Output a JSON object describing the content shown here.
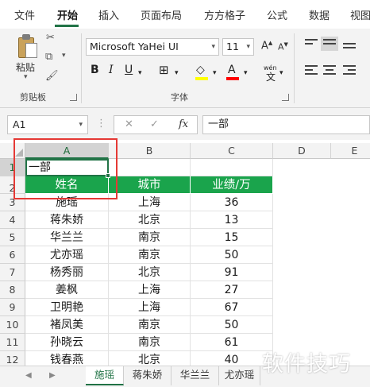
{
  "ribbon_tabs": [
    {
      "label": "文件"
    },
    {
      "label": "开始"
    },
    {
      "label": "插入"
    },
    {
      "label": "页面布局"
    },
    {
      "label": "方方格子"
    },
    {
      "label": "公式"
    },
    {
      "label": "数据"
    },
    {
      "label": "视图"
    }
  ],
  "clipboard": {
    "paste_label": "粘贴",
    "group_label": "剪贴板"
  },
  "font": {
    "name": "Microsoft YaHei UI",
    "size": "11",
    "group_label": "字体",
    "phonetic_label": "wén",
    "fill_color": "#ffff00",
    "font_color": "#ff0000"
  },
  "formula_bar": {
    "name_box": "A1",
    "fx_label": "fx",
    "formula_value": "一部"
  },
  "columns": [
    "A",
    "B",
    "C",
    "D",
    "E"
  ],
  "rows": [
    "1",
    "2",
    "3",
    "4",
    "5",
    "6",
    "7",
    "8",
    "9",
    "10",
    "11",
    "12"
  ],
  "a1_value": "一部",
  "table": {
    "headers": [
      "姓名",
      "城市",
      "业绩/万"
    ],
    "rows": [
      [
        "施瑶",
        "上海",
        "36"
      ],
      [
        "蒋朱娇",
        "北京",
        "13"
      ],
      [
        "华兰兰",
        "南京",
        "15"
      ],
      [
        "尤亦瑶",
        "南京",
        "50"
      ],
      [
        "杨秀丽",
        "北京",
        "91"
      ],
      [
        "姜枫",
        "上海",
        "27"
      ],
      [
        "卫明艳",
        "上海",
        "67"
      ],
      [
        "褚凤美",
        "南京",
        "50"
      ],
      [
        "孙晓云",
        "南京",
        "61"
      ],
      [
        "钱春燕",
        "北京",
        "40"
      ]
    ]
  },
  "sheet_tabs": [
    "施瑶",
    "蒋朱娇",
    "华兰兰",
    "尤亦瑶"
  ],
  "watermark": "软件技巧",
  "colors": {
    "accent": "#217346",
    "header_fill": "#1aa44c",
    "highlight": "#e53935"
  }
}
